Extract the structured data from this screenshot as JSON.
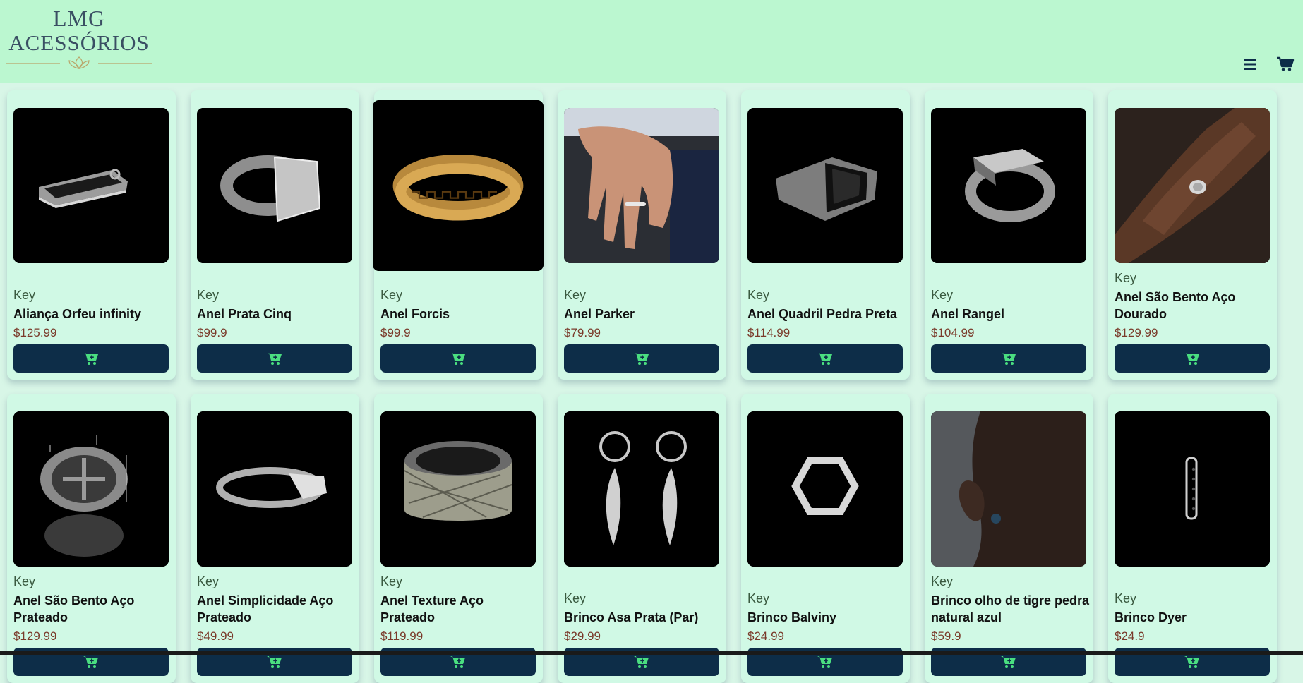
{
  "logo": {
    "line1": "LMG",
    "line2": "ACESSÓRIOS"
  },
  "nav": {
    "menu_icon": "hamburger-menu-icon",
    "cart_icon": "shopping-cart-icon",
    "icon_color": "#0d2d48"
  },
  "colors": {
    "header_bg": "#bbf7d0",
    "card_bg": "#d0f9e5",
    "button_bg": "#0d2d48",
    "button_icon": "#4ade80",
    "price": "#7a3a2a"
  },
  "products": [
    {
      "brand": "Key",
      "name": "Aliança Orfeu infinity",
      "price": "$125.99",
      "image_icon": "ring-band-icon"
    },
    {
      "brand": "Key",
      "name": "Anel Prata Cinq",
      "price": "$99.9",
      "image_icon": "signet-ring-icon"
    },
    {
      "brand": "Key",
      "name": "Anel Forcis",
      "price": "$99.9",
      "image_icon": "gold-ring-icon"
    },
    {
      "brand": "Key",
      "name": "Anel Parker",
      "price": "$79.99",
      "image_icon": "hand-ring-icon"
    },
    {
      "brand": "Key",
      "name": "Anel Quadril Pedra Preta",
      "price": "$114.99",
      "image_icon": "stone-ring-icon"
    },
    {
      "brand": "Key",
      "name": "Anel Rangel",
      "price": "$104.99",
      "image_icon": "signet-ring-icon"
    },
    {
      "brand": "Key",
      "name": "Anel São Bento Aço Dourado",
      "price": "$129.99",
      "image_icon": "hand-ring-icon"
    },
    {
      "brand": "Key",
      "name": "Anel São Bento Aço Prateado",
      "price": "$129.99",
      "image_icon": "medal-ring-icon"
    },
    {
      "brand": "Key",
      "name": "Anel Simplicidade Aço Prateado",
      "price": "$49.99",
      "image_icon": "ring-band-icon"
    },
    {
      "brand": "Key",
      "name": "Anel Texture Aço Prateado",
      "price": "$119.99",
      "image_icon": "textured-ring-icon"
    },
    {
      "brand": "Key",
      "name": "Brinco Asa Prata (Par)",
      "price": "$29.99",
      "image_icon": "wing-earrings-icon"
    },
    {
      "brand": "Key",
      "name": "Brinco Balviny",
      "price": "$24.99",
      "image_icon": "hexagon-earring-icon"
    },
    {
      "brand": "Key",
      "name": "Brinco olho de tigre pedra natural azul",
      "price": "$59.9",
      "image_icon": "ear-stud-icon"
    },
    {
      "brand": "Key",
      "name": "Brinco Dyer",
      "price": "$24.9",
      "image_icon": "hoop-earring-icon"
    }
  ]
}
